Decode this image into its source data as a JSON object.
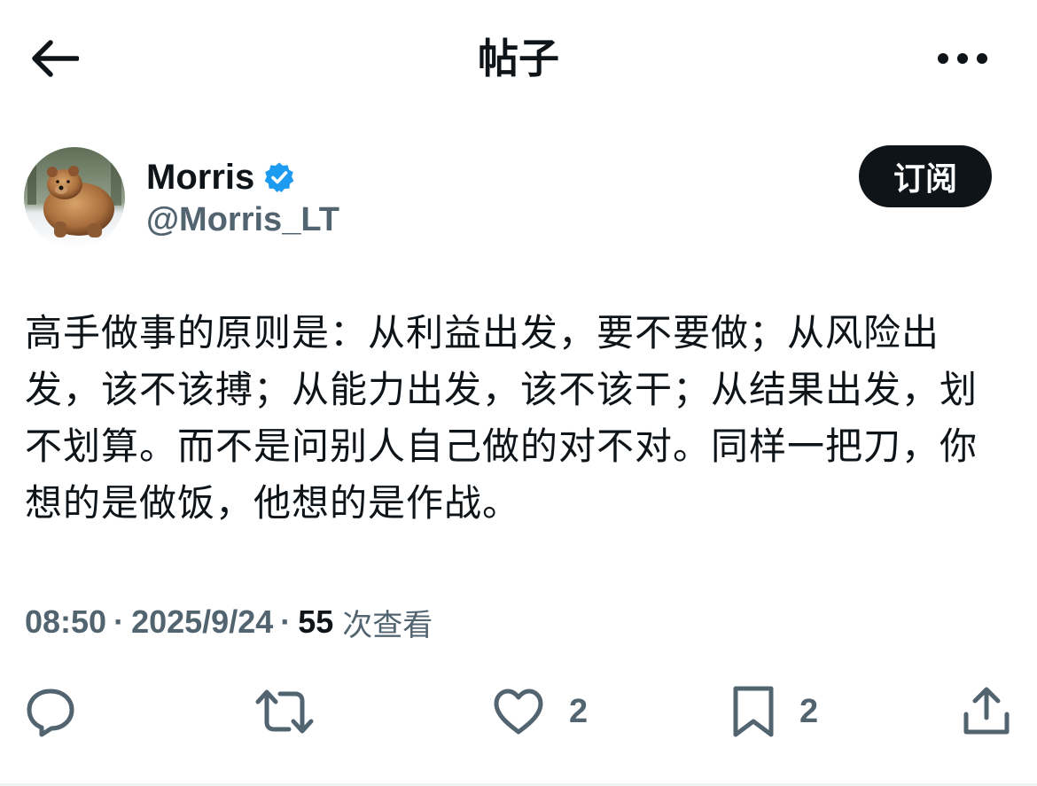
{
  "header": {
    "title": "帖子",
    "back_icon": "arrow-left-icon",
    "more_icon": "more-horizontal-icon"
  },
  "author": {
    "display_name": "Morris",
    "handle": "@Morris_LT",
    "verified": true,
    "verified_color": "#1d9bf0",
    "subscribe_label": "订阅"
  },
  "post": {
    "text": "高手做事的原则是：从利益出发，要不要做；从风险出发，该不该搏；从能力出发，该不该干；从结果出发，划不划算。而不是问别人自己做的对不对。同样一把刀，你想的是做饭，他想的是作战。"
  },
  "meta": {
    "time": "08:50",
    "date": "2025/9/24",
    "views_count": "55",
    "views_label": "次查看"
  },
  "actions": {
    "reply_icon": "reply-icon",
    "repost_icon": "repost-icon",
    "like_icon": "heart-icon",
    "like_count": "2",
    "bookmark_icon": "bookmark-icon",
    "bookmark_count": "2",
    "share_icon": "share-icon"
  },
  "colors": {
    "text_primary": "#0f1419",
    "text_secondary": "#536471",
    "button_bg": "#0f1419"
  }
}
